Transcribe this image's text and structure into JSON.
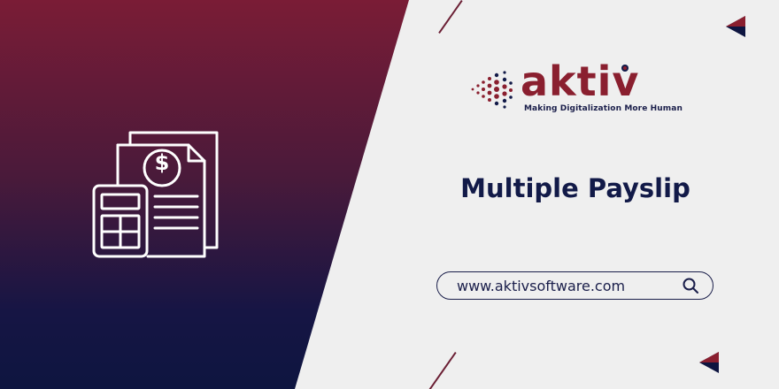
{
  "brand": {
    "name": "aktiv",
    "tagline": "Making Digitalization More Human",
    "primary_color": "#8a1f2f",
    "navy_color": "#121a48"
  },
  "banner": {
    "title": "Multiple Payslip",
    "url": "www.aktivsoftware.com",
    "illustration": "payslip-calculator-icon"
  },
  "icons": {
    "search": "search-icon",
    "dollar": "dollar-icon"
  }
}
